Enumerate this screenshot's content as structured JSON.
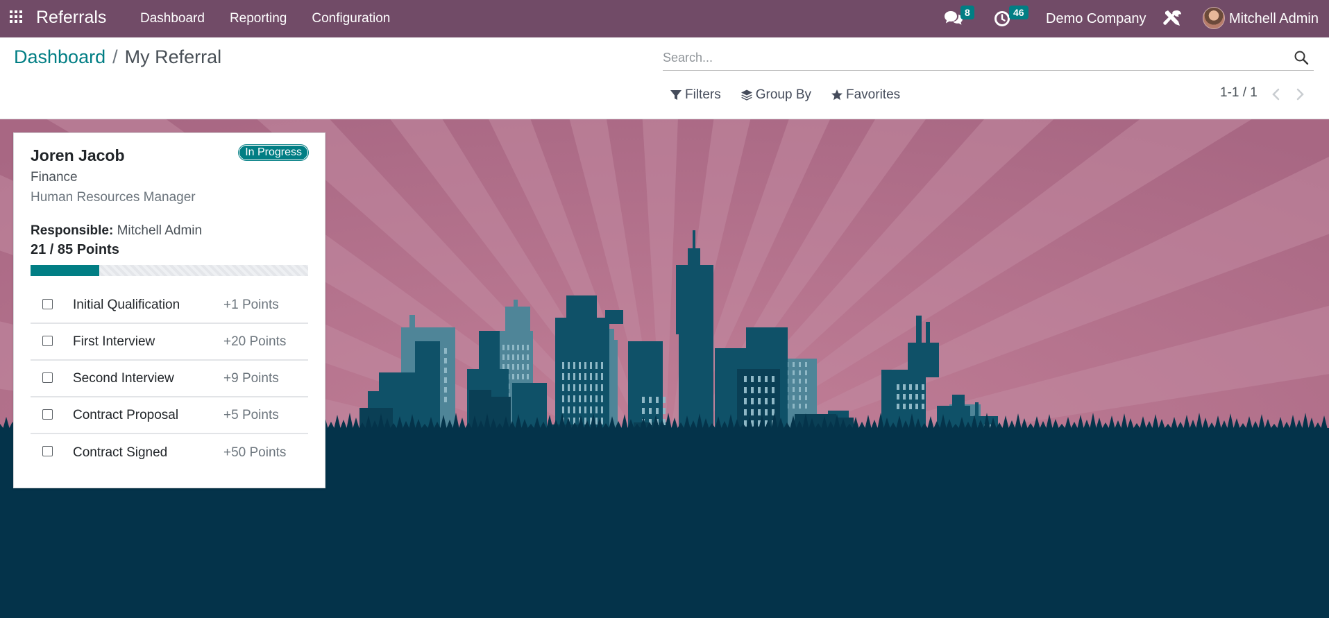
{
  "navbar": {
    "brand": "Referrals",
    "menu": [
      "Dashboard",
      "Reporting",
      "Configuration"
    ],
    "messages_count": "8",
    "activities_count": "46",
    "company": "Demo Company",
    "user": "Mitchell Admin"
  },
  "control_panel": {
    "breadcrumb": {
      "parent": "Dashboard",
      "separator": "/",
      "current": "My Referral"
    },
    "search": {
      "placeholder": "Search..."
    },
    "filters": [
      "Filters",
      "Group By",
      "Favorites"
    ],
    "pager": "1-1 / 1"
  },
  "referral_card": {
    "candidate": "Joren Jacob",
    "status": "In Progress",
    "department": "Finance",
    "job": "Human Resources Manager",
    "responsible_label": "Responsible:",
    "responsible": "Mitchell Admin",
    "points_text": "21 / 85 Points",
    "progress_fraction": 0.247,
    "stages": [
      {
        "label": "Initial Qualification",
        "points": "+1 Points"
      },
      {
        "label": "First Interview",
        "points": "+20 Points"
      },
      {
        "label": "Second Interview",
        "points": "+9 Points"
      },
      {
        "label": "Contract Proposal",
        "points": "+5 Points"
      },
      {
        "label": "Contract Signed",
        "points": "+50 Points"
      }
    ]
  },
  "colors": {
    "navbar": "#714b67",
    "accent": "#017e84",
    "sky": "#b6708b",
    "ground": "#04334a"
  }
}
